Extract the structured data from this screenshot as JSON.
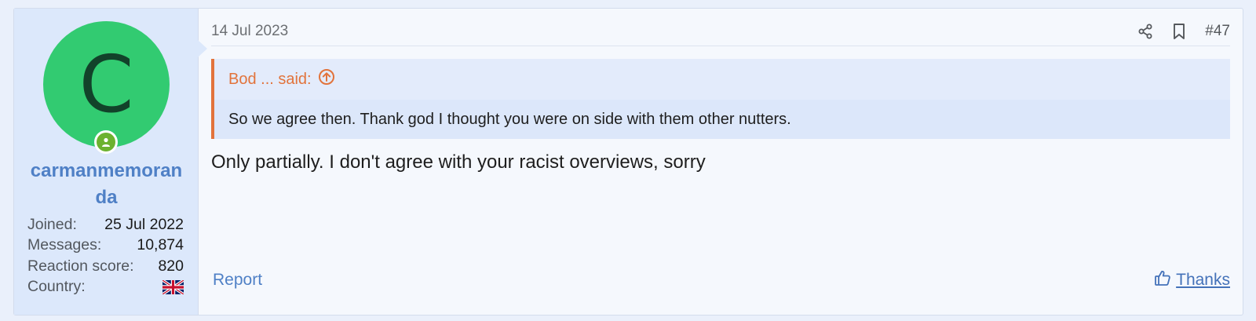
{
  "user": {
    "avatar_letter": "C",
    "username": "carmanmemoranda",
    "stats": [
      {
        "label": "Joined:",
        "value": "25 Jul 2022"
      },
      {
        "label": "Messages:",
        "value": "10,874"
      },
      {
        "label": "Reaction score:",
        "value": "820"
      },
      {
        "label": "Country:",
        "value": ""
      }
    ],
    "country_flag": "uk-flag-icon"
  },
  "post": {
    "date": "14 Jul 2023",
    "number": "#47",
    "quote": {
      "title": "Bod ... said:",
      "body": "So we agree then. Thank god I thought you were on side with them other nutters."
    },
    "message": "Only partially. I don't agree with your racist overviews, sorry",
    "report_label": "Report",
    "thanks_label": "Thanks"
  },
  "colors": {
    "accent": "#4f80c6",
    "quote_accent": "#e2733b",
    "avatar_bg": "#32cb71",
    "online": "#6cb22f"
  }
}
